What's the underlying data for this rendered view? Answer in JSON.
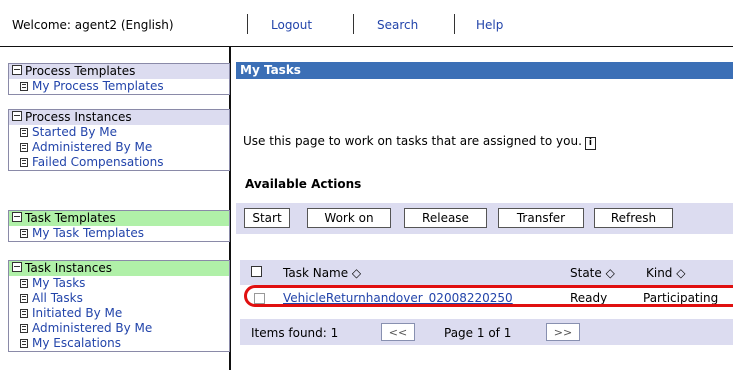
{
  "topbar": {
    "welcome": "Welcome: agent2 (English)",
    "logout": "Logout",
    "search": "Search",
    "help": "Help"
  },
  "nav": {
    "process_templates": {
      "header": "Process Templates",
      "items": [
        "My Process Templates"
      ]
    },
    "process_instances": {
      "header": "Process Instances",
      "items": [
        "Started By Me",
        "Administered By Me",
        "Failed Compensations"
      ]
    },
    "task_templates": {
      "header": "Task Templates",
      "items": [
        "My Task Templates"
      ]
    },
    "task_instances": {
      "header": "Task Instances",
      "items": [
        "My Tasks",
        "All Tasks",
        "Initiated By Me",
        "Administered By Me",
        "My Escalations"
      ]
    }
  },
  "main": {
    "title": "My Tasks",
    "description": "Use this page to work on tasks that are assigned to you.",
    "info_icon": "i",
    "available_actions": "Available Actions",
    "actions": [
      "Start",
      "Work on",
      "Release",
      "Transfer",
      "Refresh"
    ],
    "columns": {
      "name": "Task Name ◇",
      "state": "State ◇",
      "kind": "Kind ◇"
    },
    "rows": [
      {
        "name": "VehicleReturnhandover_02008220250",
        "state": "Ready",
        "kind": "Participating"
      }
    ],
    "pager": {
      "items_found": "Items found: 1",
      "prev": "<<",
      "page": "Page 1 of 1",
      "next": ">>"
    }
  },
  "colors": {
    "nav_grey": "#dcdcf0",
    "nav_green": "#b0f0a8",
    "header_blue": "#3b6fb6",
    "highlight_red": "#e01010",
    "link": "#2244aa"
  }
}
